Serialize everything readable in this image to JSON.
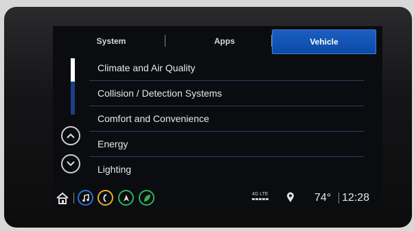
{
  "tabs": [
    {
      "label": "System"
    },
    {
      "label": "Apps"
    },
    {
      "label": "Vehicle"
    }
  ],
  "active_tab": "Vehicle",
  "menu_items": [
    {
      "label": "Climate and Air Quality"
    },
    {
      "label": "Collision / Detection Systems"
    },
    {
      "label": "Comfort and Convenience"
    },
    {
      "label": "Energy"
    },
    {
      "label": "Lighting"
    }
  ],
  "status": {
    "network": "4G LTE",
    "temperature": "74°",
    "time": "12:28"
  },
  "colors": {
    "active_tab": "#0d4aa8",
    "audio_icon": "#2f6fd6",
    "phone_icon": "#e9b21a",
    "nav_icon": "#2fb35a",
    "energy_icon": "#2fb35a",
    "scrollbar": "#1b3f88"
  },
  "icons": [
    "home-icon",
    "audio-icon",
    "phone-icon",
    "navigation-icon",
    "leaf-icon",
    "location-pin-icon",
    "chevron-up-icon",
    "chevron-down-icon"
  ]
}
